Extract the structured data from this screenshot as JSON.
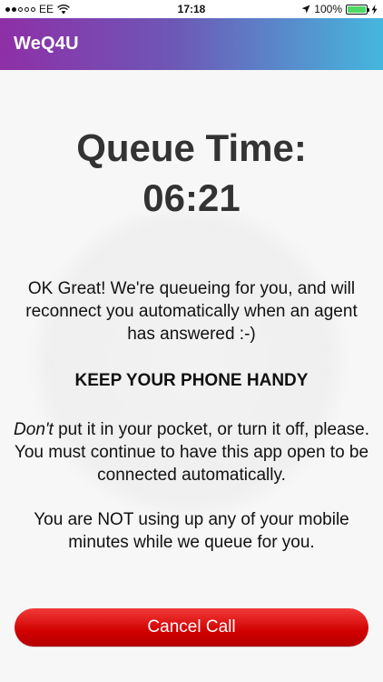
{
  "status_bar": {
    "carrier": "EE",
    "time": "17:18",
    "battery_percent": "100%"
  },
  "nav": {
    "title": "WeQ4U"
  },
  "queue": {
    "label": "Queue Time:",
    "time": "06:21"
  },
  "messages": {
    "intro": "OK Great! We're queueing for you, and will reconnect you automatically when an agent has answered :-)",
    "heading": "KEEP YOUR PHONE HANDY",
    "instruction_em": "Don't",
    "instruction_rest": " put it in your pocket, or turn it off, please. You must continue to have this app open to be connected automatically.",
    "minutes_note": "You are NOT using up any of your mobile minutes while we queue for you."
  },
  "actions": {
    "cancel_label": "Cancel Call"
  },
  "colors": {
    "nav_gradient_start": "#8e2fa6",
    "nav_gradient_end": "#45b7dd",
    "cancel_button": "#d10000",
    "battery": "#4cd964"
  }
}
